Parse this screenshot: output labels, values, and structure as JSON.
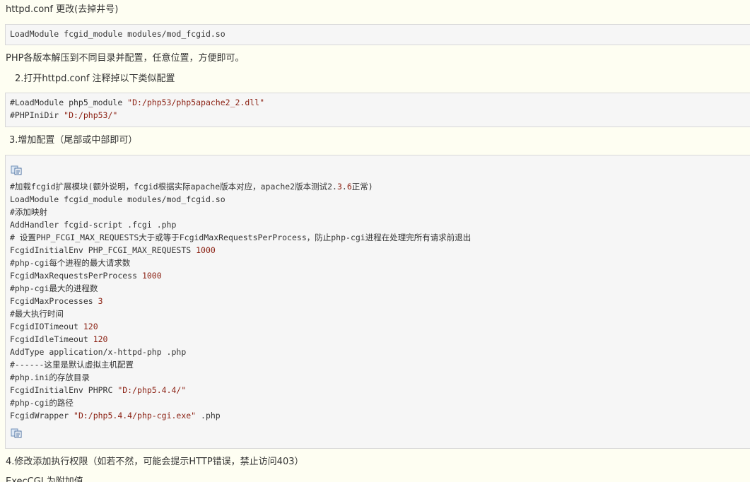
{
  "sections": {
    "intro_heading": "httpd.conf 更改(去掉井号)",
    "box1_line": "LoadModule fcgid_module modules/mod_fcgid.so",
    "php_note": "PHP各版本解压到不同目录并配置，任意位置，方便即可。",
    "step2_heading": "2.打开httpd.conf 注释掉以下类似配置",
    "box2_line1_prefix": "#LoadModule php5_module ",
    "box2_line1_str": "\"D:/php53/php5apache2_2.dll\"",
    "box2_line2_prefix": "#PHPIniDir ",
    "box2_line2_str": "\"D:/php53/\"",
    "step3_heading": "3.增加配置（尾部或中部即可）",
    "step4_heading": "4.修改添加执行权限（如若不然，可能会提示HTTP错误，禁止访问403）",
    "tail_line": "ExecCGI 为附加值"
  },
  "box3": {
    "l1_a": "#加载fcgid扩展模块(额外说明，fcgid根据实际apache版本对应，apache2版本测试2.",
    "l1_b": "3",
    "l1_c": ".",
    "l1_d": "6",
    "l1_e": "正常)",
    "l2": "LoadModule fcgid_module modules/mod_fcgid.so",
    "l3": "#添加映射",
    "l4": "AddHandler fcgid-script .fcgi .php",
    "l5": "# 设置PHP_FCGI_MAX_REQUESTS大于或等于FcgidMaxRequestsPerProcess，防止php-cgi进程在处理完所有请求前退出",
    "l6_a": "FcgidInitialEnv PHP_FCGI_MAX_REQUESTS ",
    "l6_b": "1000",
    "l7": "#php-cgi每个进程的最大请求数",
    "l8_a": "FcgidMaxRequestsPerProcess ",
    "l8_b": "1000",
    "l9": "#php-cgi最大的进程数",
    "l10_a": "FcgidMaxProcesses ",
    "l10_b": "3",
    "l11": "#最大执行时间",
    "l12_a": "FcgidIOTimeout ",
    "l12_b": "120",
    "l13_a": "FcgidIdleTimeout ",
    "l13_b": "120",
    "l14": "AddType application/x-httpd-php .php",
    "l15": "#------这里是默认虚拟主机配置",
    "l16": "#php.ini的存放目录",
    "l17_a": "FcgidInitialEnv PHPRC ",
    "l17_b": "\"D:/php5.4.4/\"",
    "l18": "#php-cgi的路径",
    "l19_a": "FcgidWrapper ",
    "l19_b": "\"D:/php5.4.4/php-cgi.exe\"",
    "l19_c": " .php"
  },
  "icons": {
    "copy_top": "copy-icon",
    "copy_bottom": "copy-icon"
  }
}
